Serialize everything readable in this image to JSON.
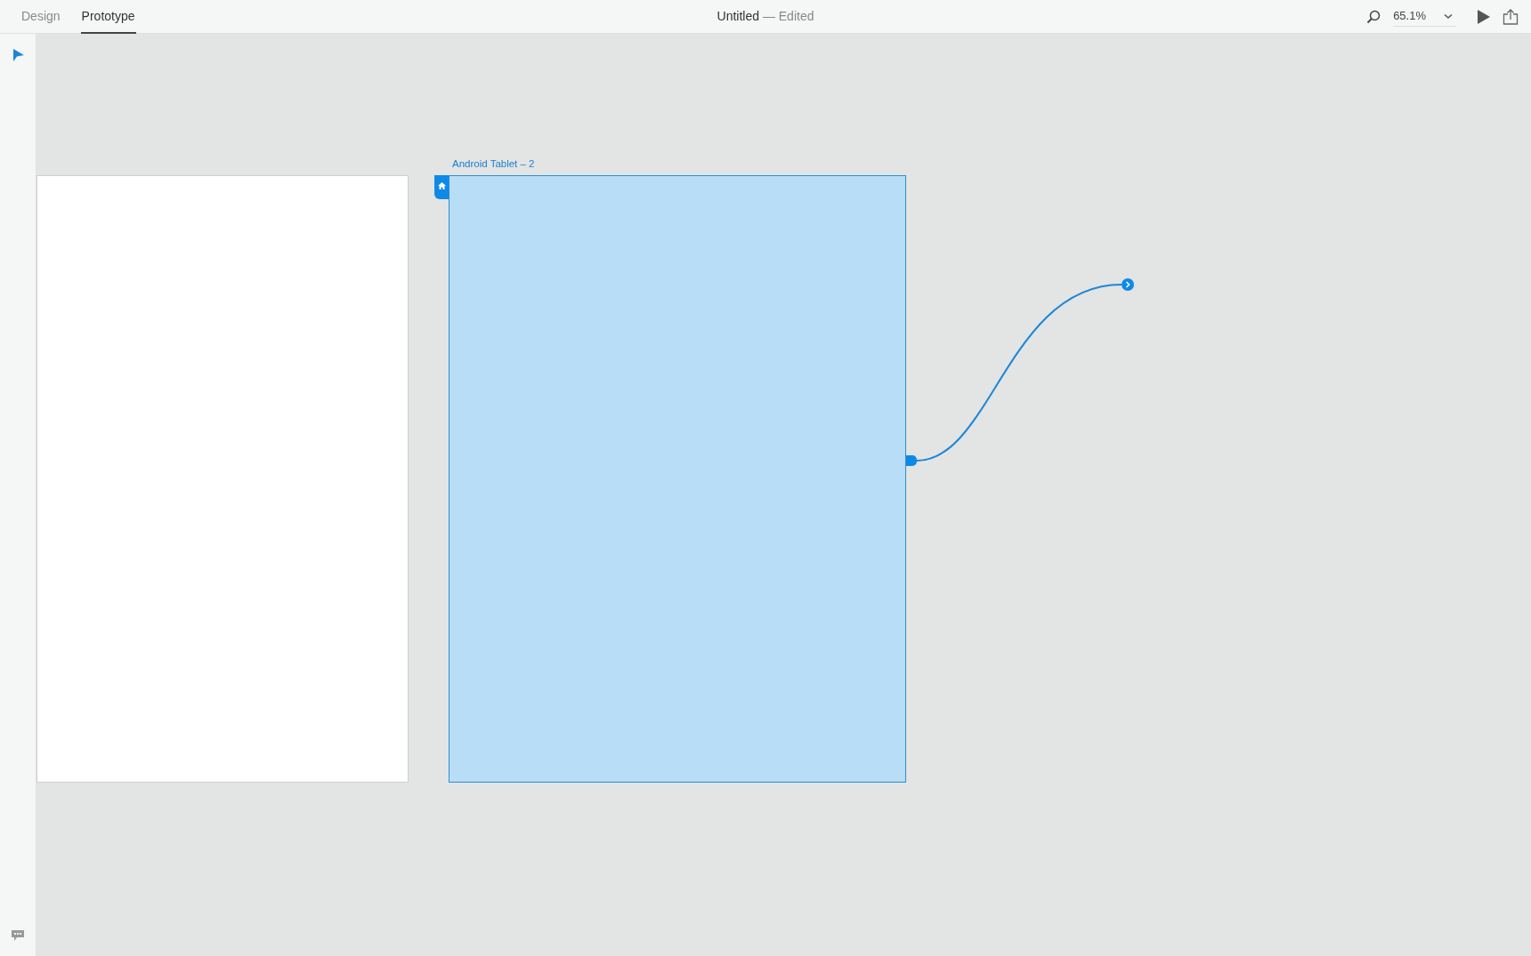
{
  "tabs": [
    {
      "label": "Design",
      "selected": false
    },
    {
      "label": "Prototype",
      "selected": true
    }
  ],
  "document": {
    "title": "Untitled",
    "status": "— Edited"
  },
  "zoom": {
    "value": "65.1%"
  },
  "artboards": [
    {
      "selected": false,
      "home": false,
      "linked": false
    },
    {
      "name": "Android Tablet – 2",
      "selected": true,
      "home": true,
      "linked": true
    }
  ]
}
